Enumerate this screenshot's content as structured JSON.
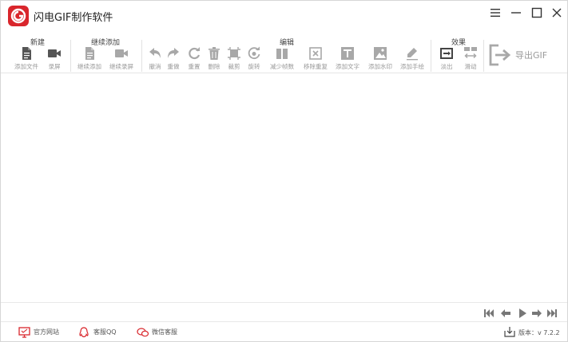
{
  "app": {
    "title": "闪电GIF制作软件"
  },
  "toolbar": {
    "groups": {
      "new": "新建",
      "continue_add": "继续添加",
      "edit": "编辑",
      "effects": "效果"
    },
    "tools": {
      "add_file": "添加文件",
      "record": "录屏",
      "continue_add": "继续添加",
      "continue_record": "继续录屏",
      "undo": "撤消",
      "redo": "重做",
      "reset": "重置",
      "delete": "删除",
      "crop": "裁剪",
      "rotate": "旋转",
      "reduce_frames": "减少帧数",
      "remove_duplicate": "移除重复",
      "add_text": "添加文字",
      "add_watermark": "添加水印",
      "add_handwriting": "添加手绘",
      "fade_out": "淡出",
      "slide": "滑动"
    },
    "export": "导出GIF"
  },
  "status": {
    "official_site": "官方网站",
    "service_qq": "客服QQ",
    "wechat_service": "微信客服",
    "version": "版本：v 7.2.2"
  },
  "colors": {
    "brand": "#d9262c",
    "icon_dark": "#555555",
    "icon_light": "#a8a8a8"
  }
}
